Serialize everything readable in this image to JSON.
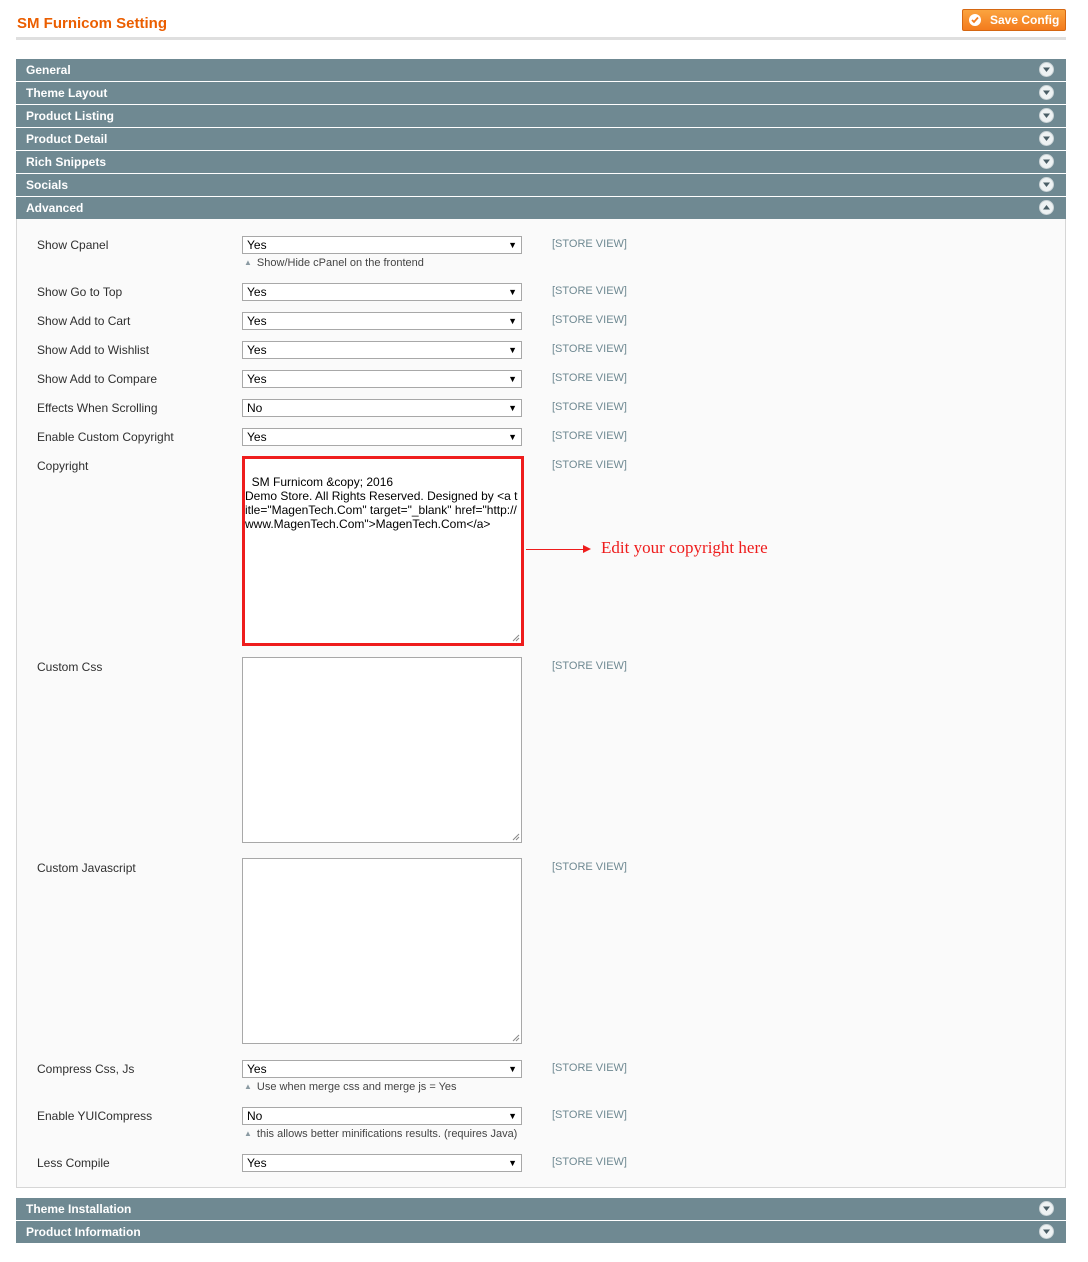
{
  "page": {
    "title": "SM Furnicom Setting",
    "save_label": "Save Config"
  },
  "sections": {
    "general": "General",
    "theme_layout": "Theme Layout",
    "product_listing": "Product Listing",
    "product_detail": "Product Detail",
    "rich_snippets": "Rich Snippets",
    "socials": "Socials",
    "advanced": "Advanced",
    "theme_installation": "Theme Installation",
    "product_information": "Product Information"
  },
  "scope_label": "[STORE VIEW]",
  "fields": {
    "show_cpanel": {
      "label": "Show Cpanel",
      "value": "Yes",
      "note": "Show/Hide cPanel on the frontend"
    },
    "show_go_to_top": {
      "label": "Show Go to Top",
      "value": "Yes"
    },
    "show_add_to_cart": {
      "label": "Show Add to Cart",
      "value": "Yes"
    },
    "show_add_to_wishlist": {
      "label": "Show Add to Wishlist",
      "value": "Yes"
    },
    "show_add_to_compare": {
      "label": "Show Add to Compare",
      "value": "Yes"
    },
    "effects_when_scrolling": {
      "label": "Effects When Scrolling",
      "value": "No"
    },
    "enable_custom_copyright": {
      "label": "Enable Custom Copyright",
      "value": "Yes"
    },
    "copyright": {
      "label": "Copyright",
      "value": "SM Furnicom &copy; 2016\nDemo Store. All Rights Reserved. Designed by <a title=\"MagenTech.Com\" target=\"_blank\" href=\"http://www.MagenTech.Com\">MagenTech.Com</a>"
    },
    "custom_css": {
      "label": "Custom Css",
      "value": ""
    },
    "custom_javascript": {
      "label": "Custom Javascript",
      "value": ""
    },
    "compress_css_js": {
      "label": "Compress Css, Js",
      "value": "Yes",
      "note": "Use when merge css and merge js = Yes"
    },
    "enable_yuicompress": {
      "label": "Enable YUICompress",
      "value": "No",
      "note": "this allows better minifications results. (requires Java)"
    },
    "less_compile": {
      "label": "Less Compile",
      "value": "Yes"
    }
  },
  "annotation": {
    "text": "Edit your copyright here",
    "color": "#ee1c1c"
  },
  "colors": {
    "header_bar": "#6f8992",
    "title": "#eb5e00",
    "save_button": "#f58b2a"
  }
}
